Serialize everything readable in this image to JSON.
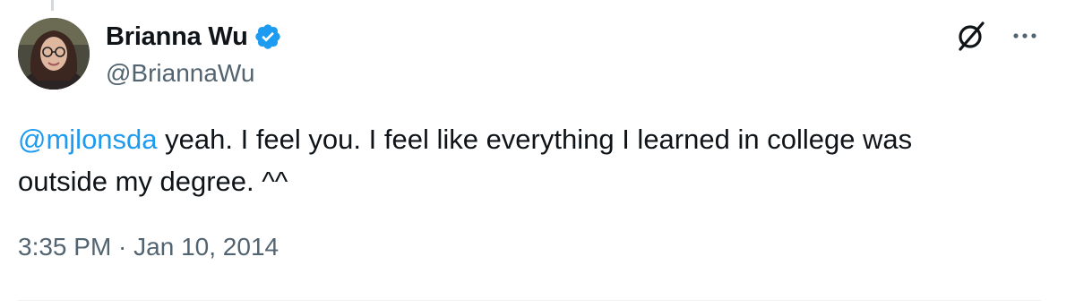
{
  "author": {
    "display_name": "Brianna Wu",
    "handle": "@BriannaWu",
    "verified": true,
    "verified_color": "#1d9bf0"
  },
  "tweet": {
    "mention": "@mjlonsda",
    "body_line1": " yeah. I feel you. I feel like everything I learned in college was",
    "body_line2": "outside my degree.  ^^",
    "time": "3:35 PM",
    "separator": " · ",
    "date": "Jan 10, 2014"
  },
  "icons": {
    "avatar": "avatar",
    "verified": "verified-badge-icon",
    "grok": "grok-icon",
    "more": "more-options-icon"
  },
  "colors": {
    "text": "#0f1419",
    "secondary": "#536471",
    "link": "#1d9bf0"
  }
}
